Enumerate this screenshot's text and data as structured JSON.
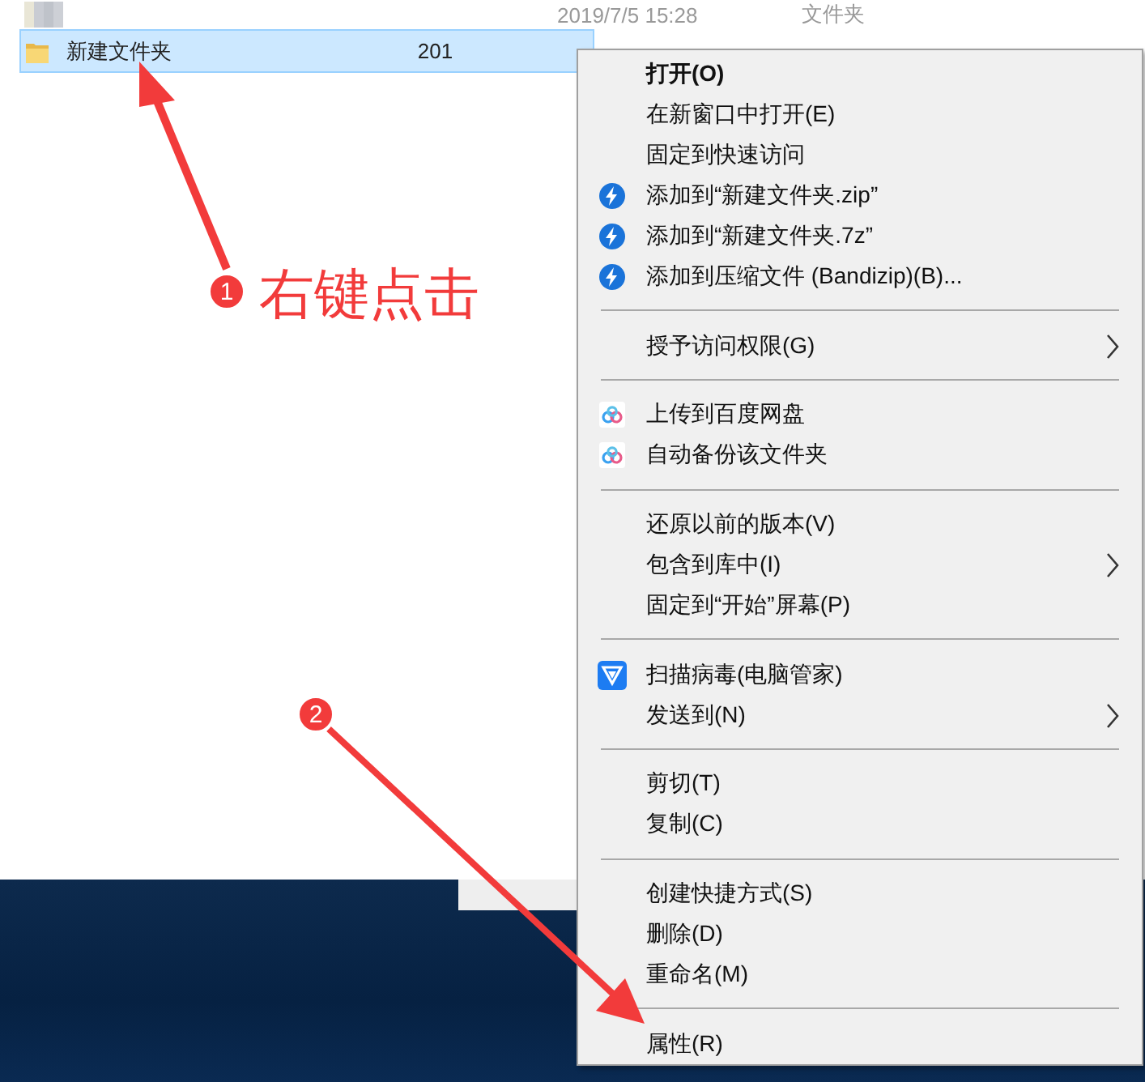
{
  "files": [
    {
      "kind": "obscured",
      "date": "2019/7/5 15:28",
      "type": "文件夹",
      "selected": false
    },
    {
      "kind": "folder",
      "name": "新建文件夹",
      "date": "201",
      "selected": true
    }
  ],
  "context_menu": [
    {
      "kind": "plain",
      "label": "打开(O)",
      "default": true
    },
    {
      "kind": "plain",
      "label": "在新窗口中打开(E)"
    },
    {
      "kind": "plain",
      "label": "固定到快速访问"
    },
    {
      "kind": "archive",
      "label": "添加到“新建文件夹.zip”"
    },
    {
      "kind": "archive",
      "label": "添加到“新建文件夹.7z”"
    },
    {
      "kind": "archive",
      "label": "添加到压缩文件 (Bandizip)(B)..."
    },
    {
      "kind": "separator"
    },
    {
      "kind": "plain",
      "label": "授予访问权限(G)",
      "submenu": true
    },
    {
      "kind": "separator"
    },
    {
      "kind": "cloud",
      "label": "上传到百度网盘"
    },
    {
      "kind": "cloud",
      "label": "自动备份该文件夹"
    },
    {
      "kind": "separator"
    },
    {
      "kind": "plain",
      "label": "还原以前的版本(V)"
    },
    {
      "kind": "plain",
      "label": "包含到库中(I)",
      "submenu": true
    },
    {
      "kind": "plain",
      "label": "固定到“开始”屏幕(P)"
    },
    {
      "kind": "separator"
    },
    {
      "kind": "antivirus",
      "label": "扫描病毒(电脑管家)"
    },
    {
      "kind": "plain",
      "label": "发送到(N)",
      "submenu": true
    },
    {
      "kind": "separator"
    },
    {
      "kind": "plain",
      "label": "剪切(T)"
    },
    {
      "kind": "plain",
      "label": "复制(C)"
    },
    {
      "kind": "separator"
    },
    {
      "kind": "plain",
      "label": "创建快捷方式(S)"
    },
    {
      "kind": "plain",
      "label": "删除(D)"
    },
    {
      "kind": "plain",
      "label": "重命名(M)"
    },
    {
      "kind": "separator"
    },
    {
      "kind": "plain",
      "label": "属性(R)"
    }
  ],
  "annotations": [
    {
      "number": "1",
      "caption": "右键点击"
    },
    {
      "number": "2"
    }
  ]
}
